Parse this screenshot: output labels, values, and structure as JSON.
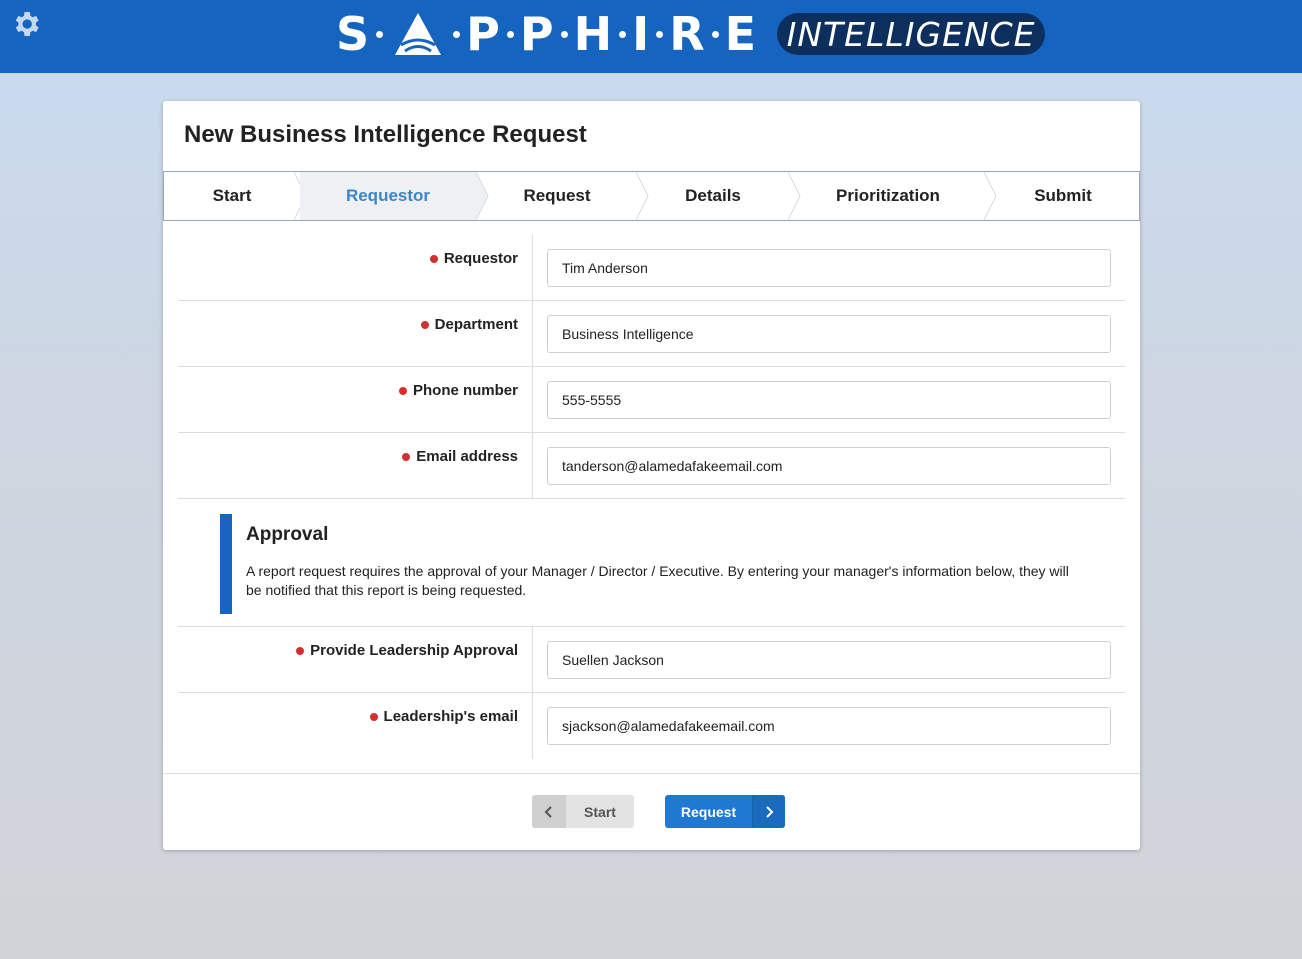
{
  "header": {
    "logo_word": "SAPPHIRE",
    "logo_letters": [
      "S",
      "P",
      "P",
      "H",
      "I",
      "R",
      "E"
    ],
    "logo_tag": "INTELLIGENCE",
    "settings_icon": "gear-icon"
  },
  "card": {
    "title": "New Business Intelligence Request"
  },
  "steps": [
    {
      "label": "Start"
    },
    {
      "label": "Requestor",
      "active": true
    },
    {
      "label": "Request"
    },
    {
      "label": "Details"
    },
    {
      "label": "Prioritization"
    },
    {
      "label": "Submit"
    }
  ],
  "fields": {
    "requestor": {
      "label": "Requestor",
      "value": "Tim Anderson"
    },
    "department": {
      "label": "Department",
      "value": "Business Intelligence"
    },
    "phone": {
      "label": "Phone number",
      "value": "555-5555"
    },
    "email": {
      "label": "Email address",
      "value": "tanderson@alamedafakeemail.com"
    },
    "leadership": {
      "label": "Provide Leadership Approval",
      "value": "Suellen Jackson"
    },
    "leadership_email": {
      "label": "Leadership's email",
      "value": "sjackson@alamedafakeemail.com"
    }
  },
  "approval": {
    "title": "Approval",
    "description": "A report request requires the approval of your Manager / Director / Executive. By entering your manager's information below, they will be notified that this report is being requested."
  },
  "nav": {
    "back_label": "Start",
    "next_label": "Request"
  },
  "colors": {
    "brand_blue": "#1565c0",
    "required_dot": "#d32f2f",
    "active_step": "#3d86c6",
    "primary_button": "#1f78d1"
  }
}
